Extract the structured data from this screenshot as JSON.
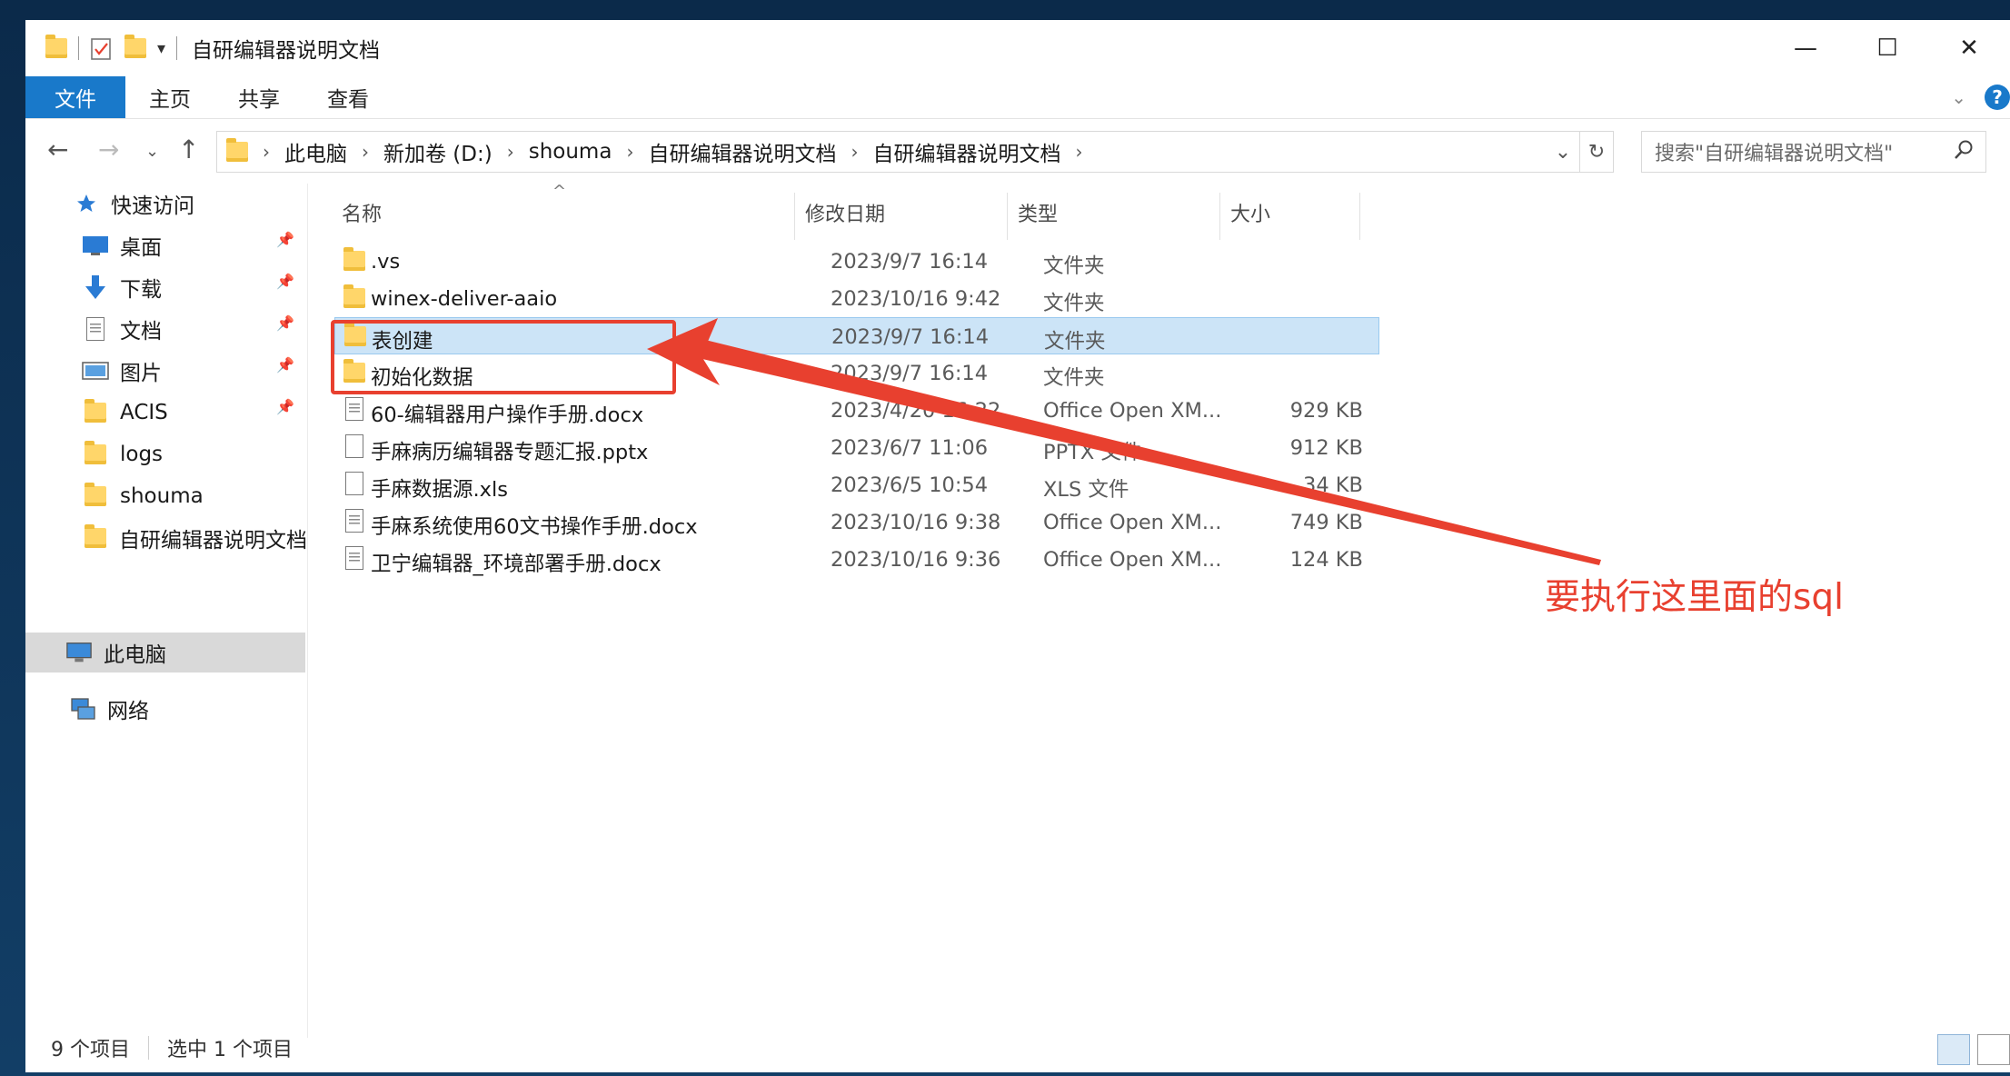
{
  "window": {
    "title": "自研编辑器说明文档",
    "controls": {
      "minimize": "—",
      "maximize": "☐",
      "close": "✕"
    }
  },
  "ribbon": {
    "tabs": [
      {
        "label": "文件"
      },
      {
        "label": "主页"
      },
      {
        "label": "共享"
      },
      {
        "label": "查看"
      }
    ],
    "help_label": "?"
  },
  "address": {
    "crumbs": [
      "此电脑",
      "新加卷 (D:)",
      "shouma",
      "自研编辑器说明文档",
      "自研编辑器说明文档"
    ]
  },
  "search": {
    "placeholder": "搜索\"自研编辑器说明文档\""
  },
  "sidebar": {
    "items": [
      {
        "label": "快速访问",
        "icon": "star-icon",
        "pinned": false
      },
      {
        "label": "桌面",
        "icon": "desktop-icon",
        "pinned": true
      },
      {
        "label": "下载",
        "icon": "download-icon",
        "pinned": true
      },
      {
        "label": "文档",
        "icon": "document-icon",
        "pinned": true
      },
      {
        "label": "图片",
        "icon": "pictures-icon",
        "pinned": true
      },
      {
        "label": "ACIS",
        "icon": "folder-icon",
        "pinned": true
      },
      {
        "label": "logs",
        "icon": "folder-icon",
        "pinned": false
      },
      {
        "label": "shouma",
        "icon": "folder-icon",
        "pinned": false
      },
      {
        "label": "自研编辑器说明文档",
        "icon": "folder-icon",
        "pinned": false
      },
      {
        "label": "此电脑",
        "icon": "computer-icon",
        "pinned": false
      },
      {
        "label": "网络",
        "icon": "network-icon",
        "pinned": false
      }
    ]
  },
  "columns": {
    "name": "名称",
    "date": "修改日期",
    "type": "类型",
    "size": "大小"
  },
  "files": [
    {
      "name": ".vs",
      "date": "2023/9/7 16:14",
      "type": "文件夹",
      "size": "",
      "icon": "folder-icon"
    },
    {
      "name": "winex-deliver-aaio",
      "date": "2023/10/16 9:42",
      "type": "文件夹",
      "size": "",
      "icon": "folder-icon"
    },
    {
      "name": "表创建",
      "date": "2023/9/7 16:14",
      "type": "文件夹",
      "size": "",
      "icon": "folder-icon",
      "selected": true
    },
    {
      "name": "初始化数据",
      "date": "2023/9/7 16:14",
      "type": "文件夹",
      "size": "",
      "icon": "folder-icon"
    },
    {
      "name": "60-编辑器用户操作手册.docx",
      "date": "2023/4/20 16:22",
      "type": "Office Open XM...",
      "size": "929 KB",
      "icon": "docx-icon"
    },
    {
      "name": "手麻病历编辑器专题汇报.pptx",
      "date": "2023/6/7 11:06",
      "type": "PPTX 文件",
      "size": "912 KB",
      "icon": "file-icon"
    },
    {
      "name": "手麻数据源.xls",
      "date": "2023/6/5 10:54",
      "type": "XLS 文件",
      "size": "34 KB",
      "icon": "file-icon"
    },
    {
      "name": "手麻系统使用60文书操作手册.docx",
      "date": "2023/10/16 9:38",
      "type": "Office Open XM...",
      "size": "749 KB",
      "icon": "docx-icon"
    },
    {
      "name": "卫宁编辑器_环境部署手册.docx",
      "date": "2023/10/16 9:36",
      "type": "Office Open XM...",
      "size": "124 KB",
      "icon": "docx-icon"
    }
  ],
  "status": {
    "count": "9 个项目",
    "selected": "选中 1 个项目"
  },
  "annotation": {
    "text": "要执行这里面的sql",
    "color": "#e8402f"
  },
  "colors": {
    "accent": "#1979ca",
    "selection": "#cce4f7"
  }
}
